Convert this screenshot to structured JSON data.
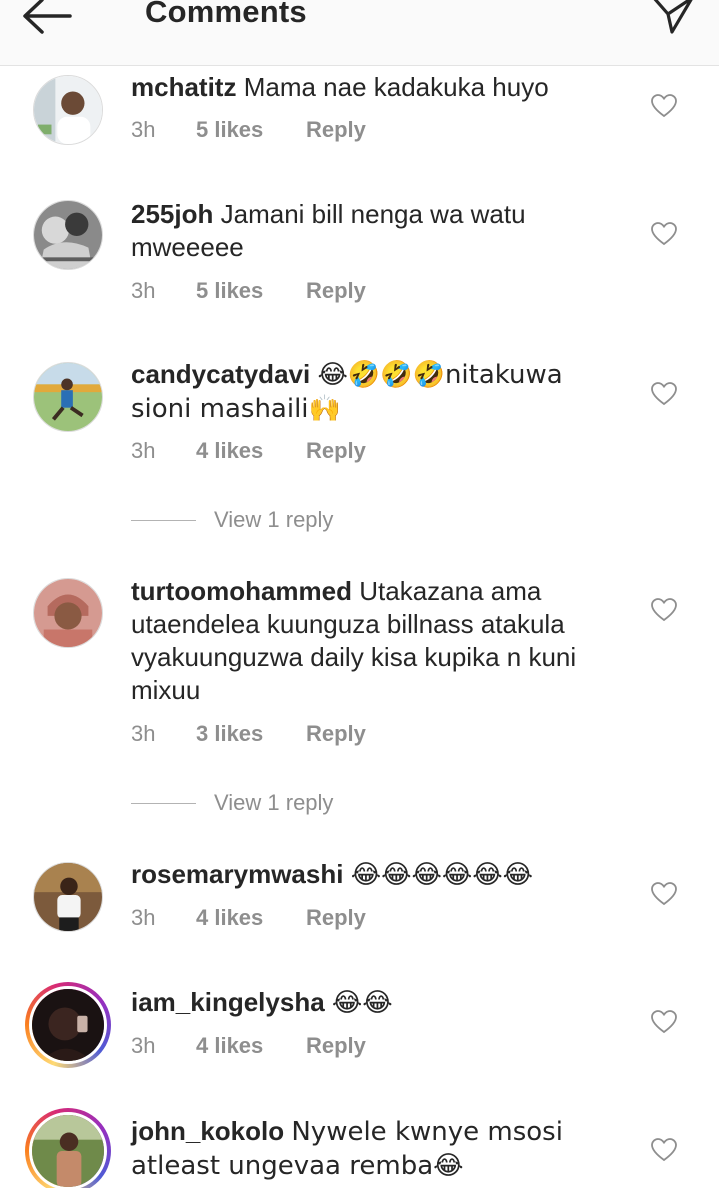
{
  "header": {
    "title": "Comments",
    "back_icon": "back-arrow-icon",
    "send_icon": "send-direct-icon"
  },
  "comments": [
    {
      "username": "mchatitz",
      "text": "Mama nae kadakuka huyo",
      "time": "3h",
      "likes": "5 likes",
      "reply": "Reply"
    },
    {
      "username": "255joh",
      "text": "Jamani bill nenga wa watu mweeeee",
      "time": "3h",
      "likes": "5 likes",
      "reply": "Reply"
    },
    {
      "username": "candycatydavi",
      "text": "😂🤣🤣🤣nitakuwa sioni mashaili🙌",
      "time": "3h",
      "likes": "4 likes",
      "reply": "Reply",
      "view_replies": "View 1 reply"
    },
    {
      "username": "turtoomohammed",
      "text": "Utakazana ama utaendelea kuunguza billnass atakula vyakuunguzwa daily kisa kupika n kuni mixuu",
      "time": "3h",
      "likes": "3 likes",
      "reply": "Reply",
      "view_replies": "View 1 reply"
    },
    {
      "username": "rosemarymwashi",
      "text": "😂😂😂😂😂😂",
      "time": "3h",
      "likes": "4 likes",
      "reply": "Reply"
    },
    {
      "username": "iam_kingelysha",
      "text": "😂😂",
      "time": "3h",
      "likes": "4 likes",
      "reply": "Reply"
    },
    {
      "username": "john_kokolo",
      "text": "Nywele kwnye msosi atleast ungevaa remba😂"
    }
  ],
  "colors": {
    "text": "#262626",
    "secondary": "#8e8e8e",
    "header_bg": "#fafafa",
    "divider": "#e3e3e3"
  },
  "icons": {
    "like": "heart-outline-icon",
    "avatar": "user-avatar"
  }
}
